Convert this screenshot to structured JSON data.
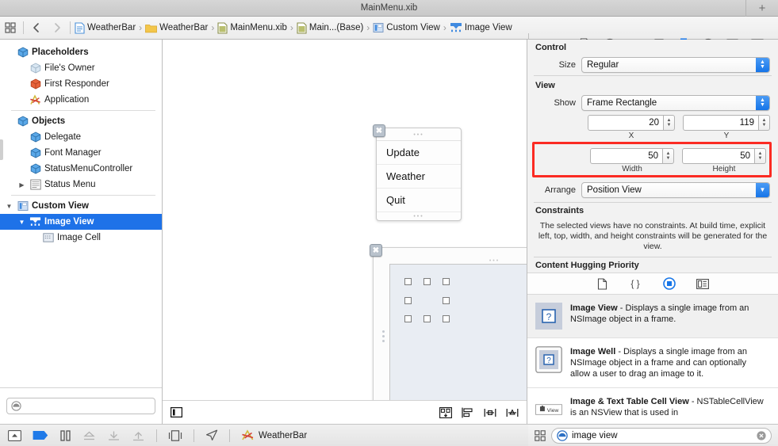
{
  "window": {
    "title": "MainMenu.xib",
    "add_button": "+"
  },
  "jumpbar": {
    "breadcrumbs": [
      {
        "label": "WeatherBar",
        "icon": "project-file-icon"
      },
      {
        "label": "WeatherBar",
        "icon": "folder-icon"
      },
      {
        "label": "MainMenu.xib",
        "icon": "xib-file-icon"
      },
      {
        "label": "Main...(Base)",
        "icon": "xib-file-icon"
      },
      {
        "label": "Custom View",
        "icon": "custom-view-icon"
      },
      {
        "label": "Image View",
        "icon": "image-view-icon"
      }
    ],
    "inspector_tabs": [
      {
        "name": "file-inspector",
        "selected": false
      },
      {
        "name": "quick-help-inspector",
        "selected": false
      },
      {
        "name": "identity-inspector",
        "selected": false
      },
      {
        "name": "attributes-inspector",
        "selected": false
      },
      {
        "name": "size-inspector",
        "selected": true
      },
      {
        "name": "connections-inspector",
        "selected": false
      },
      {
        "name": "bindings-inspector",
        "selected": false
      },
      {
        "name": "view-effects-inspector",
        "selected": false
      }
    ]
  },
  "navigator": {
    "tree": [
      {
        "label": "Placeholders",
        "icon": "cube-icon",
        "depth": 0,
        "group": true,
        "disclosure": "",
        "selected": false
      },
      {
        "label": "File's Owner",
        "icon": "cube-gray-icon",
        "depth": 1,
        "group": false,
        "disclosure": "",
        "selected": false
      },
      {
        "label": "First Responder",
        "icon": "first-responder-icon",
        "depth": 1,
        "group": false,
        "disclosure": "",
        "selected": false
      },
      {
        "label": "Application",
        "icon": "application-icon",
        "depth": 1,
        "group": false,
        "disclosure": "",
        "selected": false
      },
      {
        "label": "Objects",
        "icon": "cube-icon",
        "depth": 0,
        "group": true,
        "disclosure": "",
        "selected": false
      },
      {
        "label": "Delegate",
        "icon": "cube-icon",
        "depth": 1,
        "group": false,
        "disclosure": "",
        "selected": false
      },
      {
        "label": "Font Manager",
        "icon": "cube-icon",
        "depth": 1,
        "group": false,
        "disclosure": "",
        "selected": false
      },
      {
        "label": "StatusMenuController",
        "icon": "cube-icon",
        "depth": 1,
        "group": false,
        "disclosure": "",
        "selected": false
      },
      {
        "label": "Status Menu",
        "icon": "menu-icon",
        "depth": 1,
        "group": false,
        "disclosure": "▶",
        "selected": false
      },
      {
        "label": "Custom View",
        "icon": "custom-view-icon",
        "depth": 0,
        "group": true,
        "disclosure": "▼",
        "selected": false
      },
      {
        "label": "Image View",
        "icon": "image-view-icon",
        "depth": 1,
        "group": true,
        "disclosure": "▼",
        "selected": true
      },
      {
        "label": "Image Cell",
        "icon": "image-cell-icon",
        "depth": 2,
        "group": false,
        "disclosure": "",
        "selected": false
      }
    ],
    "filter_placeholder": "",
    "filter_value": ""
  },
  "canvas": {
    "menu_object": {
      "items": [
        "Update",
        "Weather",
        "Quit"
      ]
    },
    "custom_view_object": {
      "label": ""
    },
    "bottom_left_toggle": "canvas-panel-toggle",
    "bottom_icons": [
      "auto-layout-issues-icon",
      "align-icon",
      "pin-icon",
      "resolve-auto-layout-icon"
    ]
  },
  "inspector": {
    "control": {
      "header": "Control",
      "size_label": "Size",
      "size_value": "Regular"
    },
    "view": {
      "header": "View",
      "show_label": "Show",
      "show_value": "Frame Rectangle",
      "x_value": "20",
      "x_caption": "X",
      "y_value": "119",
      "y_caption": "Y",
      "width_value": "50",
      "width_caption": "Width",
      "height_value": "50",
      "height_caption": "Height",
      "arrange_label": "Arrange",
      "arrange_value": "Position View",
      "highlight_color": "#fb2b23"
    },
    "constraints": {
      "header": "Constraints",
      "text": "The selected views have no constraints. At build time, explicit left, top, width, and height constraints will be generated for the view."
    },
    "content_hugging": {
      "header": "Content Hugging Priority",
      "icons": [
        {
          "name": "file-template-library-icon",
          "selected": false
        },
        {
          "name": "code-snippet-library-icon",
          "selected": false
        },
        {
          "name": "object-library-icon",
          "selected": true
        },
        {
          "name": "media-library-icon",
          "selected": false
        }
      ]
    }
  },
  "library": {
    "items": [
      {
        "title": "Image View",
        "description": " - Displays a single image from an NSImage object in a frame.",
        "icon": "image-view-thumb-icon",
        "selected": true
      },
      {
        "title": "Image Well",
        "description": " - Displays a single image from an NSImage object in a frame and can optionally allow a user to drag an image to it.",
        "icon": "image-well-thumb-icon",
        "selected": false
      },
      {
        "title": "Image & Text Table Cell View",
        "description": " - NSTableCellView is an NSView that is used in",
        "icon": "table-cell-view-thumb-icon",
        "selected": false
      }
    ],
    "search_value": "image view",
    "search_icon": "library-search-icon",
    "clear_icon": "clear-icon",
    "view_toggle_icon": "grid-view-icon"
  },
  "debugbar": {
    "icons": [
      "hide-debug-area-icon",
      "breakpoints-icon",
      "pause-icon",
      "step-over-icon",
      "step-into-icon",
      "step-out-icon",
      "simulate-document-icon",
      "location-icon"
    ],
    "process_name": "WeatherBar",
    "process_icon": "application-icon"
  }
}
